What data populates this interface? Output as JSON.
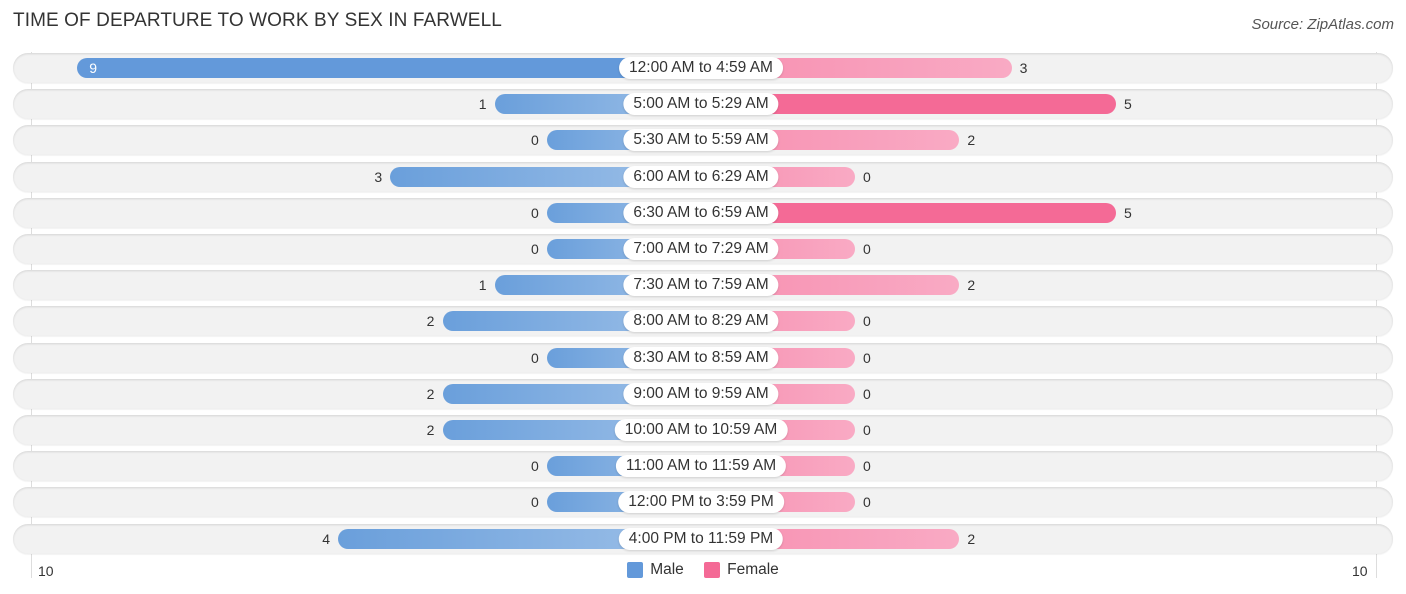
{
  "title": "TIME OF DEPARTURE TO WORK BY SEX IN FARWELL",
  "source": "Source: ZipAtlas.com",
  "chart_data": {
    "type": "bar",
    "orientation": "horizontal-diverging",
    "title": "TIME OF DEPARTURE TO WORK BY SEX IN FARWELL",
    "categories": [
      "12:00 AM to 4:59 AM",
      "5:00 AM to 5:29 AM",
      "5:30 AM to 5:59 AM",
      "6:00 AM to 6:29 AM",
      "6:30 AM to 6:59 AM",
      "7:00 AM to 7:29 AM",
      "7:30 AM to 7:59 AM",
      "8:00 AM to 8:29 AM",
      "8:30 AM to 8:59 AM",
      "9:00 AM to 9:59 AM",
      "10:00 AM to 10:59 AM",
      "11:00 AM to 11:59 AM",
      "12:00 PM to 3:59 PM",
      "4:00 PM to 11:59 PM"
    ],
    "series": [
      {
        "name": "Male",
        "color": "#6399da",
        "values": [
          9,
          1,
          0,
          3,
          0,
          0,
          1,
          2,
          0,
          2,
          2,
          0,
          0,
          4
        ]
      },
      {
        "name": "Female",
        "color": "#f46a96",
        "values": [
          3,
          5,
          2,
          0,
          5,
          0,
          2,
          0,
          0,
          0,
          0,
          0,
          0,
          2
        ]
      }
    ],
    "axis": {
      "left_tick": "10",
      "right_tick": "10",
      "range": [
        0,
        10
      ]
    },
    "legend": {
      "position": "bottom-center",
      "items": [
        "Male",
        "Female"
      ]
    }
  }
}
